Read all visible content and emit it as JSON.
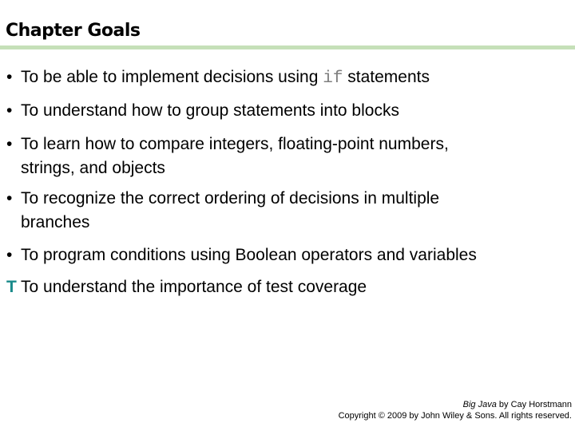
{
  "slide": {
    "title": "Chapter Goals",
    "accent_rule_color": "#c5e0b8",
    "items": [
      {
        "bullet": "•",
        "pre": "To be able to implement decisions using ",
        "code": "if",
        "post": " statements"
      },
      {
        "bullet": "•",
        "text": "To understand how to group statements into blocks"
      },
      {
        "bullet": "•",
        "line1": "To learn how to compare integers, floating-point numbers,",
        "line2": "strings, and objects"
      },
      {
        "bullet": "•",
        "line1": "To recognize the correct ordering of decisions in multiple",
        "line2": "branches"
      },
      {
        "bullet": "•",
        "text": "To program conditions using Boolean operators and variables"
      },
      {
        "bullet": "T",
        "bullet_color": "#1a8a8a",
        "text": "To understand the importance of test coverage"
      }
    ],
    "footer": {
      "book_title": "Big Java",
      "author": " by Cay Horstmann",
      "copyright": "Copyright © 2009 by John Wiley & Sons.  All rights reserved."
    }
  }
}
